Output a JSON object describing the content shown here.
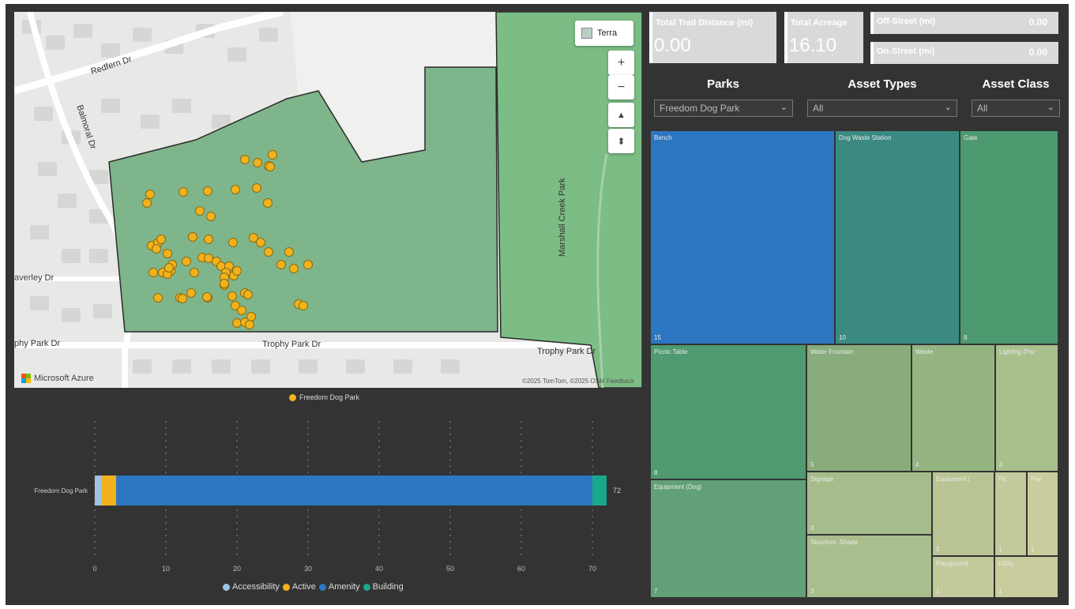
{
  "map": {
    "streets": [
      "Redfern Dr",
      "Balmoral Dr",
      "averley Dr",
      "phy Park Dr",
      "Trophy Park Dr",
      "Trophy Park Dr",
      "Marshall Creek Park"
    ],
    "style_button": "Terra",
    "controls": [
      "+",
      "−",
      "▲",
      "⬍"
    ],
    "attribution": "©2025 TomTom, ©2025 OSM  Feedback",
    "logo_text": "Microsoft Azure",
    "park_color": "#7fb58a",
    "point_color": "#f2b21b",
    "legend": "Freedom Dog Park"
  },
  "kpis": {
    "trail_label": "Total Trail Distance (mi)",
    "trail_value": "0.00",
    "acreage_label": "Total Acreage",
    "acreage_value": "16.10",
    "offstreet_label": "Off-Street (mi)",
    "offstreet_value": "0.00",
    "onstreet_label": "On-Street (mi)",
    "onstreet_value": "0.00"
  },
  "slicers": {
    "parks_title": "Parks",
    "parks_value": "Freedom Dog Park",
    "types_title": "Asset Types",
    "types_value": "All",
    "class_title": "Asset Class",
    "class_value": "All"
  },
  "treemap": [
    {
      "label": "Bench",
      "value": "15",
      "color": "#2d76c2"
    },
    {
      "label": "Dog Waste Station",
      "value": "10",
      "color": "#3a8a82"
    },
    {
      "label": "Gate",
      "value": "8",
      "color": "#4d9970"
    },
    {
      "label": "Picnic Table",
      "value": "8",
      "color": "#4f9a70"
    },
    {
      "label": "Water Fountain",
      "value": "5",
      "color": "#88ac7c"
    },
    {
      "label": "Waste",
      "value": "4",
      "color": "#94b582"
    },
    {
      "label": "Lighting (Par",
      "value": "3",
      "color": "#a9bf8c"
    },
    {
      "label": "Equipment (Dog)",
      "value": "7",
      "color": "#62a078"
    },
    {
      "label": "Signage",
      "value": "3",
      "color": "#a6bd8b"
    },
    {
      "label": "Equipment (",
      "value": "2",
      "color": "#b9c495"
    },
    {
      "label": "Pic",
      "value": "1",
      "color": "#c2c99a"
    },
    {
      "label": "Pav",
      "value": "1",
      "color": "#c9cc9c"
    },
    {
      "label": "Structure: Shade",
      "value": "3",
      "color": "#a9be8c"
    },
    {
      "label": "Playground",
      "value": "1",
      "color": "#c2c99a"
    },
    {
      "label": "Utility",
      "value": "1",
      "color": "#c9cc9c"
    }
  ],
  "chart_data": {
    "type": "bar",
    "orientation": "horizontal",
    "stacked": true,
    "categories": [
      "Freedom Dog Park"
    ],
    "series": [
      {
        "name": "Accessibility",
        "values": [
          1
        ],
        "color": "#9fc3e6"
      },
      {
        "name": "Active",
        "values": [
          2
        ],
        "color": "#f2b21b"
      },
      {
        "name": "Amenity",
        "values": [
          67
        ],
        "color": "#2d76c2"
      },
      {
        "name": "Building",
        "values": [
          2
        ],
        "color": "#1aa88a"
      }
    ],
    "total_label": "72",
    "xlim": [
      0,
      72
    ],
    "xticks": [
      0,
      10,
      20,
      30,
      40,
      50,
      60,
      70
    ],
    "grid": true,
    "legend_position": "bottom"
  }
}
